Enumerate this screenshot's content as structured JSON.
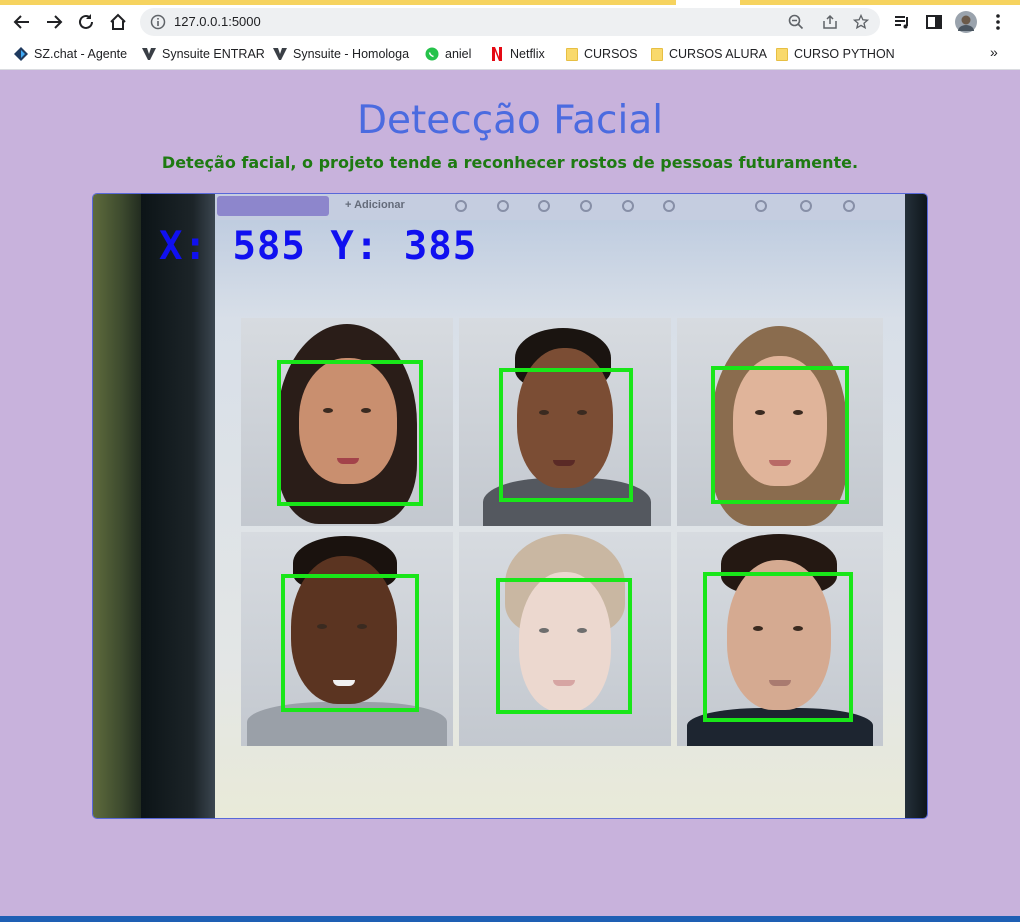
{
  "browser": {
    "url": "127.0.0.1:5000",
    "bookmarks": [
      {
        "label": "SZ.chat - Agente",
        "icon": "sz-chat-icon"
      },
      {
        "label": "Synsuite ENTRAR",
        "icon": "synsuite-icon"
      },
      {
        "label": "Synsuite - Homologa",
        "icon": "synsuite-icon"
      },
      {
        "label": "aniel",
        "icon": "whatsapp-icon"
      },
      {
        "label": "Netflix",
        "icon": "netflix-icon"
      },
      {
        "label": "CURSOS",
        "icon": "folder-icon"
      },
      {
        "label": "CURSOS ALURA",
        "icon": "folder-icon"
      },
      {
        "label": "CURSO PYTHON",
        "icon": "folder-icon"
      }
    ],
    "more_bookmarks": "»",
    "accent_color": "#f6d35f"
  },
  "page": {
    "title": "Detecção Facial",
    "subtitle": "Deteção facial, o projeto tende a reconhecer rostos de pessoas futuramente.",
    "background_color": "#c8b2dc",
    "title_color": "#4b6be0",
    "subtitle_color": "#1e7a12"
  },
  "video": {
    "coordinates_overlay": "X: 585 Y: 385",
    "detected_faces": 6,
    "box_color": "#19e619",
    "screen_toolbar": {
      "add_label": "+ Adicionar"
    }
  }
}
